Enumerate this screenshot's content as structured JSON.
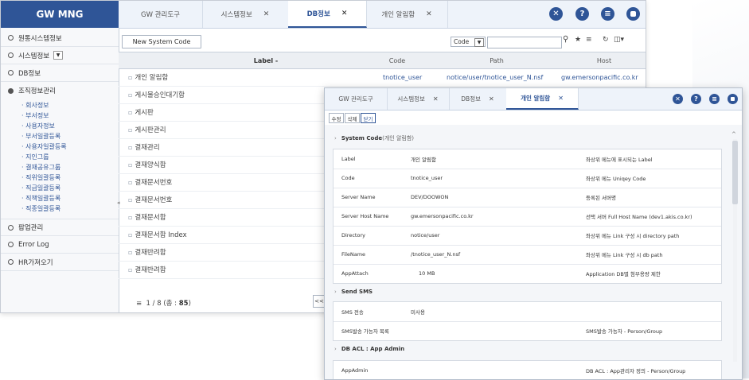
{
  "app": {
    "logo": "GW MNG"
  },
  "main_tabs": [
    {
      "label": "GW 관리도구",
      "closable": false,
      "active": false
    },
    {
      "label": "시스템정보",
      "closable": true,
      "active": false
    },
    {
      "label": "DB정보",
      "closable": true,
      "active": true
    },
    {
      "label": "개인 알림함",
      "closable": true,
      "active": false
    }
  ],
  "top_icons": [
    "close-circle-icon",
    "help-icon",
    "menu-icon",
    "window-icon"
  ],
  "sidebar": {
    "menus": [
      {
        "label": "원통시스템정보",
        "dropdown": false
      },
      {
        "label": "시스템정보",
        "dropdown": true
      },
      {
        "label": "DB정보",
        "dropdown": false
      },
      {
        "label": "조직정보관리",
        "dropdown": false,
        "open": true
      },
      {
        "label": "팝업관리",
        "dropdown": false
      },
      {
        "label": "Error Log",
        "dropdown": false
      },
      {
        "label": "HR가져오기",
        "dropdown": false
      }
    ],
    "submenus": [
      "회사정보",
      "부서정보",
      "사용자정보",
      "부서일괄등록",
      "사용자일괄등록",
      "지인그룹",
      "결재공유그룹",
      "직위일괄등록",
      "직급일괄등록",
      "직책일괄등록",
      "직종일괄등록"
    ]
  },
  "toolbar": {
    "new_button": "New System Code",
    "search_select": "Code",
    "search_value": ""
  },
  "list": {
    "columns": [
      "Label",
      "Code",
      "Path",
      "Host"
    ],
    "sort_indicator": "-",
    "rows": [
      {
        "label": "개인 알림함",
        "code": "tnotice_user",
        "path": "notice/user/tnotice_user_N.nsf",
        "host": "gw.emersonpacific.co.kr"
      },
      {
        "label": "게시물승인대기함",
        "code": "",
        "path": "",
        "host": ""
      },
      {
        "label": "게시판",
        "code": "",
        "path": "",
        "host": ""
      },
      {
        "label": "게시판관리",
        "code": "",
        "path": "",
        "host": ""
      },
      {
        "label": "결재관리",
        "code": "",
        "path": "",
        "host": ""
      },
      {
        "label": "결재양식함",
        "code": "",
        "path": "",
        "host": ""
      },
      {
        "label": "결재문서번호",
        "code": "",
        "path": "",
        "host": ""
      },
      {
        "label": "결재문서번호",
        "code": "",
        "path": "",
        "host": ""
      },
      {
        "label": "결재문서함",
        "code": "",
        "path": "",
        "host": ""
      },
      {
        "label": "결재문서함 Index",
        "code": "",
        "path": "",
        "host": ""
      },
      {
        "label": "결재반려함",
        "code": "",
        "path": "",
        "host": ""
      },
      {
        "label": "결재반려함",
        "code": "",
        "path": "",
        "host": ""
      }
    ],
    "pager_text": "1 / 8 (",
    "pager_total_label": "총 :",
    "pager_total": "85",
    "pager_close": ")",
    "pager_prefix": "≡",
    "pager_prev": "<<"
  },
  "popup": {
    "tabs": [
      {
        "label": "GW 관리도구",
        "closable": false,
        "active": false
      },
      {
        "label": "시스템정보",
        "closable": true,
        "active": false
      },
      {
        "label": "DB정보",
        "closable": true,
        "active": false
      },
      {
        "label": "개인 알림함",
        "closable": true,
        "active": true
      }
    ],
    "actions": [
      {
        "label": "수정",
        "active": false
      },
      {
        "label": "삭제",
        "active": false
      },
      {
        "label": "닫기",
        "active": true
      }
    ],
    "sections": [
      {
        "title": "System Code",
        "subtitle": "(개인 알림함)",
        "rows": [
          {
            "name": "Label",
            "value": "개인 알림함",
            "desc": "좌상위 메뉴에 표시되는 Label"
          },
          {
            "name": "Code",
            "value": "tnotice_user",
            "desc": "좌상위 메뉴 Uniqey Code"
          },
          {
            "name": "Server Name",
            "value": "DEV/DOOWON",
            "desc": "등록된 서버명"
          },
          {
            "name": "Server Host Name",
            "value": "gw.emersonpacific.co.kr",
            "desc": "선택 서버 Full Host Name (dev1.akis.co.kr)"
          },
          {
            "name": "Directory",
            "value": "notice/user",
            "desc": "좌상위 메뉴 Link 구성 시 directory path"
          },
          {
            "name": "FileName",
            "value": "/tnotice_user_N.nsf",
            "desc": "좌상위 메뉴 Link 구성 시 db path"
          },
          {
            "name": "AppAttach",
            "value": "10 MB",
            "desc": "Application DB별 첨부용량 제한"
          }
        ]
      },
      {
        "title": "Send SMS",
        "subtitle": "",
        "rows": [
          {
            "name": "SMS 전송",
            "value": "미사용",
            "desc": ""
          },
          {
            "name": "SMS발송 가능자 목록",
            "value": "",
            "desc": "SMS발송 가능자 - Person/Group"
          }
        ]
      },
      {
        "title": "DB ACL : App Admin",
        "subtitle": "",
        "rows": [
          {
            "name": "AppAdmin",
            "value": "",
            "desc": "DB ACL : App관리자 정의 - Person/Group"
          }
        ]
      }
    ]
  },
  "colors": {
    "brand": "#2f5597",
    "tab_bg": "#eef3fa",
    "sidebar_bg": "#f7f8fa"
  }
}
